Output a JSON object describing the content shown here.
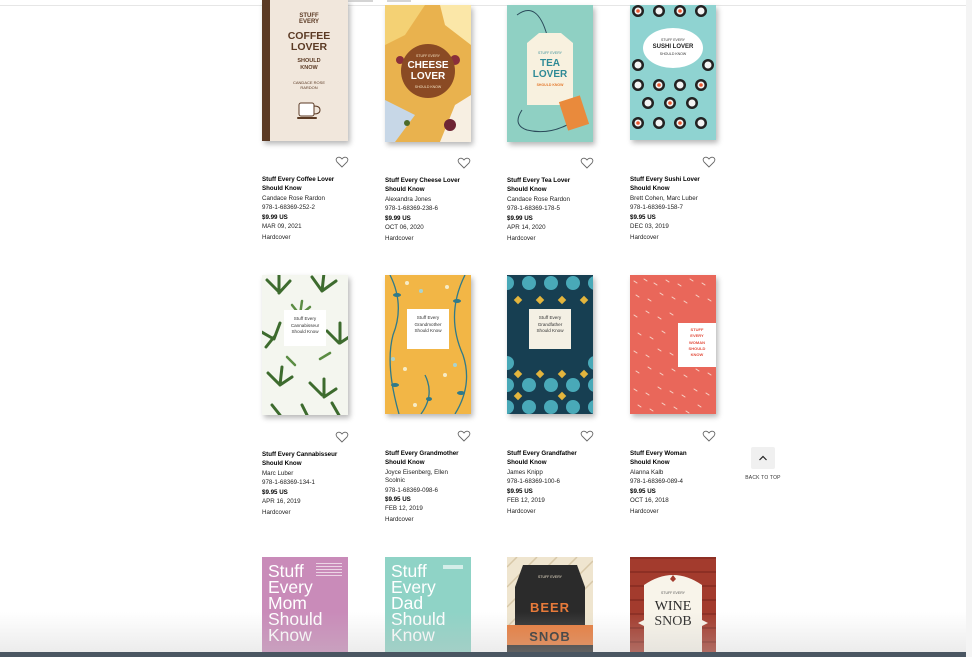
{
  "books": [
    {
      "title_line1": "Stuff Every Coffee Lover",
      "title_line2": "Should Know",
      "author": "Candace Rose Rardon",
      "isbn": "978-1-68369-252-2",
      "price": "$9.99 US",
      "date": "MAR 09, 2021",
      "format": "Hardcover",
      "cover": {
        "l1": "STUFF",
        "l2": "EVERY",
        "l3": "COFFEE",
        "l4": "LOVER",
        "l5": "SHOULD",
        "l6": "KNOW",
        "l7": "CANDACE ROSE",
        "l8": "RARDON"
      }
    },
    {
      "title_line1": "Stuff Every Cheese Lover",
      "title_line2": "Should Know",
      "author": "Alexandra Jones",
      "isbn": "978-1-68369-238-6",
      "price": "$9.99 US",
      "date": "OCT 06, 2020",
      "format": "Hardcover",
      "cover": {
        "l1": "STUFF EVERY",
        "l2": "CHEESE",
        "l3": "LOVER",
        "l4": "SHOULD KNOW"
      }
    },
    {
      "title_line1": "Stuff Every Tea Lover",
      "title_line2": "Should Know",
      "author": "Candace Rose Rardon",
      "isbn": "978-1-68369-178-5",
      "price": "$9.99 US",
      "date": "APR 14, 2020",
      "format": "Hardcover",
      "cover": {
        "l1": "STUFF EVERY",
        "l2": "TEA",
        "l3": "LOVER",
        "l4": "SHOULD KNOW"
      }
    },
    {
      "title_line1": "Stuff Every Sushi Lover",
      "title_line2": "Should Know",
      "author": "Brett Cohen, Marc Luber",
      "isbn": "978-1-68369-158-7",
      "price": "$9.95 US",
      "date": "DEC 03, 2019",
      "format": "Hardcover",
      "cover": {
        "l1": "STUFF EVERY",
        "l2": "SUSHI LOVER",
        "l3": "SHOULD KNOW"
      }
    },
    {
      "title_line1": "Stuff Every Cannabisseur",
      "title_line2": "Should Know",
      "author": "Marc Luber",
      "isbn": "978-1-68369-134-1",
      "price": "$9.95 US",
      "date": "APR 16, 2019",
      "format": "Hardcover",
      "cover": {
        "l1": "Stuff Every",
        "l2": "Cannabisseur",
        "l3": "Should Know"
      }
    },
    {
      "title_line1": "Stuff Every Grandmother",
      "title_line2": "Should Know",
      "author": "Joyce Eisenberg, Ellen",
      "author2": "Scolnic",
      "isbn": "978-1-68369-098-6",
      "price": "$9.95 US",
      "date": "FEB 12, 2019",
      "format": "Hardcover",
      "cover": {
        "l1": "Stuff Every",
        "l2": "Grandmother",
        "l3": "Should Know"
      }
    },
    {
      "title_line1": "Stuff Every Grandfather",
      "title_line2": "Should Know",
      "author": "James Knipp",
      "isbn": "978-1-68369-100-6",
      "price": "$9.95 US",
      "date": "FEB 12, 2019",
      "format": "Hardcover",
      "cover": {
        "l1": "Stuff Every",
        "l2": "Grandfather",
        "l3": "Should Know"
      }
    },
    {
      "title_line1": "Stuff Every Woman",
      "title_line2": "Should Know",
      "author": "Alanna Kalb",
      "isbn": "978-1-68369-089-4",
      "price": "$9.95 US",
      "date": "OCT 16, 2018",
      "format": "Hardcover",
      "cover": {
        "l1": "STUFF",
        "l2": "EVERY",
        "l3": "WOMAN",
        "l4": "SHOULD",
        "l5": "KNOW"
      }
    },
    {
      "cover": {
        "l1": "Stuff",
        "l2": "Every",
        "l3": "Mom",
        "l4": "Should",
        "l5": "Know"
      }
    },
    {
      "cover": {
        "l1": "Stuff",
        "l2": "Every",
        "l3": "Dad",
        "l4": "Should",
        "l5": "Know"
      }
    },
    {
      "cover": {
        "l1": "STUFF EVERY",
        "l2": "BEER",
        "l3": "SNOB"
      }
    },
    {
      "cover": {
        "l1": "STUFF EVERY",
        "l2": "WINE",
        "l3": "SNOB"
      }
    }
  ],
  "back_to_top": {
    "label": "BACK TO TOP"
  },
  "icons": {
    "wishlist": "heart-outline-icon",
    "back_to_top": "chevron-up-icon"
  },
  "colors": {
    "accent": "#000000",
    "background": "#ffffff"
  }
}
